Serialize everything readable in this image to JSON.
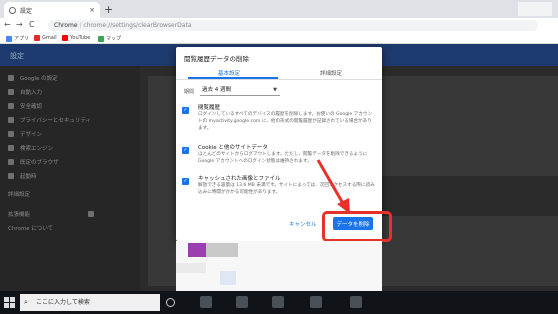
{
  "browser": {
    "tab_title": "設定",
    "tab_close": "×",
    "new_tab": "+",
    "back": "←",
    "forward": "→",
    "reload": "C",
    "address_site": "Chrome",
    "address_path": "chrome://settings/clearBrowserData",
    "bookmarks": [
      {
        "label": "アプリ",
        "color": "#4285f4"
      },
      {
        "label": "Gmail",
        "color": "#d93025"
      },
      {
        "label": "YouTube",
        "color": "#ff0000"
      },
      {
        "label": "マップ",
        "color": "#34a853"
      }
    ]
  },
  "settings": {
    "title": "設定",
    "sidebar": [
      "Google の設定",
      "自動入力",
      "安全確認",
      "プライバシーとセキュリティ",
      "デザイン",
      "検索エンジン",
      "既定のブラウザ",
      "起動時",
      "詳細設定",
      "拡張機能",
      "Chrome について"
    ]
  },
  "dialog": {
    "title": "閲覧履歴データの削除",
    "tabs": [
      "基本設定",
      "詳細設定"
    ],
    "period_label": "期間",
    "period_value": "過去 4 週間",
    "options": [
      {
        "title": "閲覧履歴",
        "desc": "ログインしているすべてのデバイスの履歴を削除します。お使いの Google アカウントの myactivity.google.com に、他の形式の閲覧履歴が記録されている場合があります。",
        "checked": true
      },
      {
        "title": "Cookie と他のサイトデータ",
        "desc": "ほとんどのサイトからログアウトします。ただし、閲覧データを削除できるように Google アカウントへのログイン状態は維持されます。",
        "checked": true
      },
      {
        "title": "キャッシュされた画像とファイル",
        "desc": "解放できる容量は 13.6 MB 未満です。サイトによっては、次回アクセスする際に読み込みに時間がかかる可能性があります。",
        "checked": true
      }
    ],
    "cancel_label": "キャンセル",
    "delete_label": "データを削除"
  },
  "taskbar": {
    "search_placeholder": "ここに入力して検索"
  },
  "colors": {
    "accent": "#1a73e8",
    "highlight": "#e8312a"
  }
}
